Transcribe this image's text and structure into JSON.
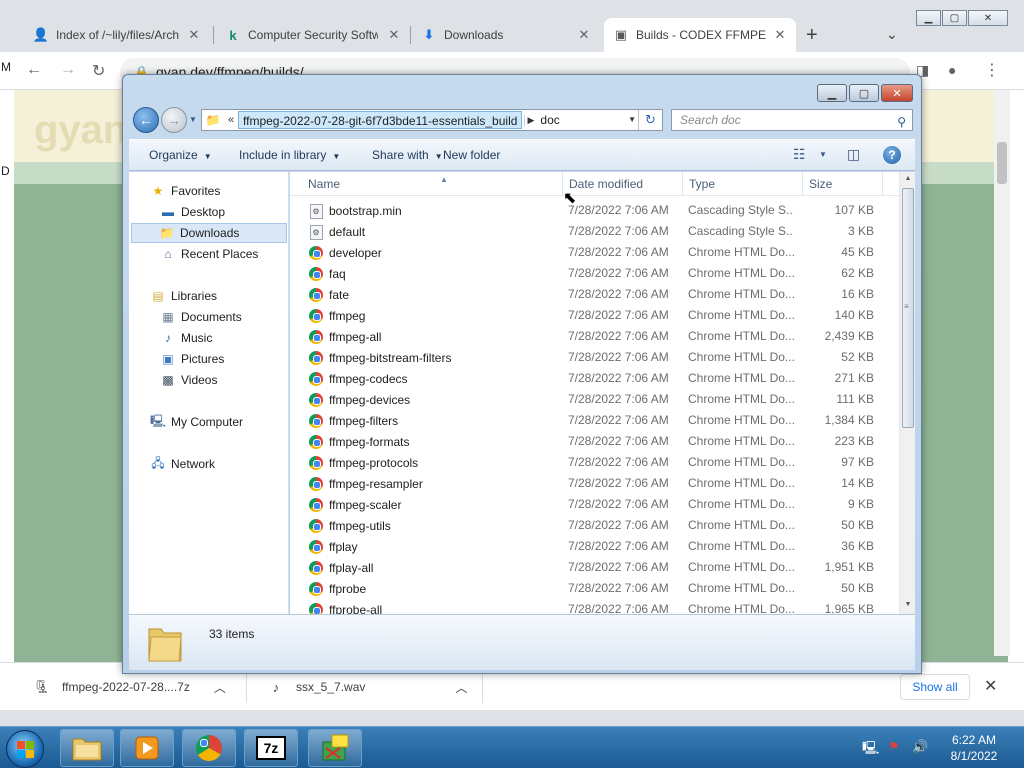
{
  "browser": {
    "tabs": [
      {
        "title": "Index of /~lily/files/Arch",
        "icon": "person-icon",
        "close": "✕"
      },
      {
        "title": "Computer Security Softw",
        "icon": "kaspersky-k-icon",
        "close": "✕"
      },
      {
        "title": "Downloads",
        "icon": "download-icon",
        "close": "✕"
      },
      {
        "title": "Builds - CODEX FFMPEG",
        "icon": "puzzle-icon",
        "close": "✕"
      }
    ],
    "address": "gyan.dev/ffmpeg/builds/",
    "page_logo": "gyan",
    "left_edge_letters": [
      "M",
      "D"
    ],
    "downloads_bar": {
      "items": [
        {
          "name": "ffmpeg-2022-07-28....7z",
          "icon": "archive-icon"
        },
        {
          "name": "ssx_5_7.wav",
          "icon": "audio-file-icon"
        }
      ],
      "show_all": "Show all"
    }
  },
  "explorer": {
    "breadcrumb": {
      "overflow": "«",
      "parent": "ffmpeg-2022-07-28-git-6f7d3bde11-essentials_build",
      "current": "doc"
    },
    "search_placeholder": "Search doc",
    "commands": {
      "organize": "Organize",
      "include_in_library": "Include in library",
      "share_with": "Share with",
      "new_folder": "New folder",
      "help": "?"
    },
    "nav_pane": {
      "favorites": {
        "label": "Favorites",
        "items": [
          "Desktop",
          "Downloads",
          "Recent Places"
        ]
      },
      "libraries": {
        "label": "Libraries",
        "items": [
          "Documents",
          "Music",
          "Pictures",
          "Videos"
        ]
      },
      "computer": "My Computer",
      "network": "Network"
    },
    "columns": {
      "name": "Name",
      "date": "Date modified",
      "type": "Type",
      "size": "Size"
    },
    "files": [
      {
        "name": "bootstrap.min",
        "date": "7/28/2022 7:06 AM",
        "type": "Cascading Style S...",
        "size": "107 KB",
        "icon": "css-file-icon"
      },
      {
        "name": "default",
        "date": "7/28/2022 7:06 AM",
        "type": "Cascading Style S...",
        "size": "3 KB",
        "icon": "css-file-icon"
      },
      {
        "name": "developer",
        "date": "7/28/2022 7:06 AM",
        "type": "Chrome HTML Do...",
        "size": "45 KB",
        "icon": "chrome-html-icon"
      },
      {
        "name": "faq",
        "date": "7/28/2022 7:06 AM",
        "type": "Chrome HTML Do...",
        "size": "62 KB",
        "icon": "chrome-html-icon"
      },
      {
        "name": "fate",
        "date": "7/28/2022 7:06 AM",
        "type": "Chrome HTML Do...",
        "size": "16 KB",
        "icon": "chrome-html-icon"
      },
      {
        "name": "ffmpeg",
        "date": "7/28/2022 7:06 AM",
        "type": "Chrome HTML Do...",
        "size": "140 KB",
        "icon": "chrome-html-icon"
      },
      {
        "name": "ffmpeg-all",
        "date": "7/28/2022 7:06 AM",
        "type": "Chrome HTML Do...",
        "size": "2,439 KB",
        "icon": "chrome-html-icon"
      },
      {
        "name": "ffmpeg-bitstream-filters",
        "date": "7/28/2022 7:06 AM",
        "type": "Chrome HTML Do...",
        "size": "52 KB",
        "icon": "chrome-html-icon"
      },
      {
        "name": "ffmpeg-codecs",
        "date": "7/28/2022 7:06 AM",
        "type": "Chrome HTML Do...",
        "size": "271 KB",
        "icon": "chrome-html-icon"
      },
      {
        "name": "ffmpeg-devices",
        "date": "7/28/2022 7:06 AM",
        "type": "Chrome HTML Do...",
        "size": "111 KB",
        "icon": "chrome-html-icon"
      },
      {
        "name": "ffmpeg-filters",
        "date": "7/28/2022 7:06 AM",
        "type": "Chrome HTML Do...",
        "size": "1,384 KB",
        "icon": "chrome-html-icon"
      },
      {
        "name": "ffmpeg-formats",
        "date": "7/28/2022 7:06 AM",
        "type": "Chrome HTML Do...",
        "size": "223 KB",
        "icon": "chrome-html-icon"
      },
      {
        "name": "ffmpeg-protocols",
        "date": "7/28/2022 7:06 AM",
        "type": "Chrome HTML Do...",
        "size": "97 KB",
        "icon": "chrome-html-icon"
      },
      {
        "name": "ffmpeg-resampler",
        "date": "7/28/2022 7:06 AM",
        "type": "Chrome HTML Do...",
        "size": "14 KB",
        "icon": "chrome-html-icon"
      },
      {
        "name": "ffmpeg-scaler",
        "date": "7/28/2022 7:06 AM",
        "type": "Chrome HTML Do...",
        "size": "9 KB",
        "icon": "chrome-html-icon"
      },
      {
        "name": "ffmpeg-utils",
        "date": "7/28/2022 7:06 AM",
        "type": "Chrome HTML Do...",
        "size": "50 KB",
        "icon": "chrome-html-icon"
      },
      {
        "name": "ffplay",
        "date": "7/28/2022 7:06 AM",
        "type": "Chrome HTML Do...",
        "size": "36 KB",
        "icon": "chrome-html-icon"
      },
      {
        "name": "ffplay-all",
        "date": "7/28/2022 7:06 AM",
        "type": "Chrome HTML Do...",
        "size": "1,951 KB",
        "icon": "chrome-html-icon"
      },
      {
        "name": "ffprobe",
        "date": "7/28/2022 7:06 AM",
        "type": "Chrome HTML Do...",
        "size": "50 KB",
        "icon": "chrome-html-icon"
      },
      {
        "name": "ffprobe-all",
        "date": "7/28/2022 7:06 AM",
        "type": "Chrome HTML Do...",
        "size": "1,965 KB",
        "icon": "chrome-html-icon"
      }
    ],
    "status": "33 items"
  },
  "taskbar": {
    "apps": [
      "file-explorer-icon",
      "media-player-icon",
      "chrome-icon",
      "7zip-icon",
      "installer-icon"
    ],
    "seven_zip_label": "7z",
    "time": "6:22 AM",
    "date": "8/1/2022"
  }
}
